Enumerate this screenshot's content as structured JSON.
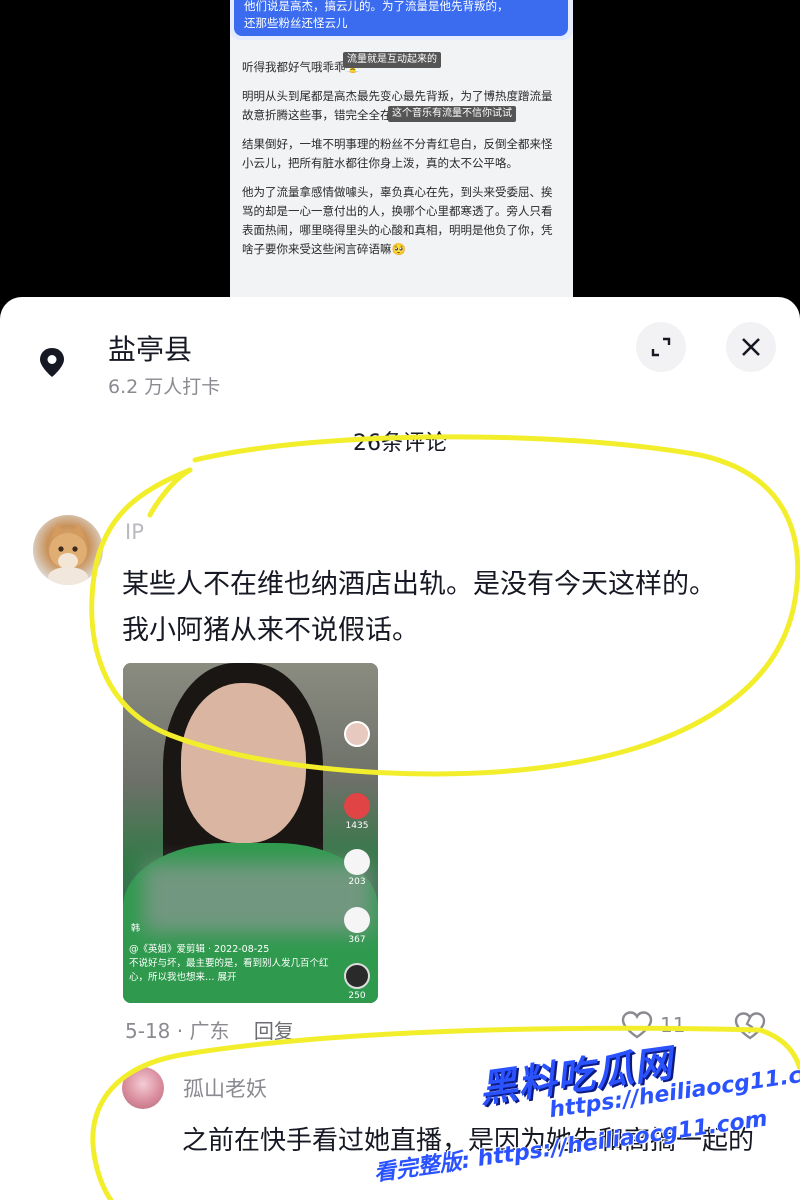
{
  "background_chat": {
    "highlight_lines": [
      "他们说是高杰，搞云儿的。为了流量是他先背叛的，",
      "还那些粉丝还怪云儿"
    ],
    "overlay_tags": [
      "流量就是互动起来的",
      "这个音乐有流量不信你试试"
    ],
    "paragraphs": [
      "听得我都好气哦乖乖😤",
      "明明从头到尾都是高杰最先变心最先背叛，为了博热度蹭流量故意折腾这些事，错完全全在他身上！",
      "结果倒好，一堆不明事理的粉丝不分青红皂白，反倒全都来怪小云儿，把所有脏水都往你身上泼，真的太不公平咯。",
      "他为了流量拿感情做噱头，辜负真心在先，到头来受委屈、挨骂的却是一心一意付出的人，换哪个心里都寒透了。旁人只看表面热闹，哪里晓得里头的心酸和真相，明明是他负了你，凭啥子要你来受这些闲言碎语嘛🥺"
    ]
  },
  "location": {
    "icon": "location-pin-icon",
    "name": "盐亭县",
    "checkins": "6.2 万人打卡"
  },
  "comments_header": "26条评论",
  "comment": {
    "ip_label": "IP",
    "text": "某些人不在维也纳酒店出轨。是没有今天这样的。我小阿猪从来不说假话。",
    "video": {
      "caption_author": "@《英姐》爱剪辑 · 2022-08-25",
      "caption_text": "不说好与坏，最主要的是，看到别人发几百个红心，所以我也想来… 展开",
      "corner_text": "韩",
      "counts": [
        "1435",
        "203",
        "367",
        "250"
      ]
    },
    "date_location": "5-18 · 广东",
    "reply_label": "回复",
    "like_count": "11"
  },
  "reply": {
    "name": "孤山老妖",
    "text": "之前在快手看过她直播，是因为她先和高搞一起的"
  },
  "watermark": {
    "title": "黑料吃瓜网",
    "url": "https://heiliaocg11.com",
    "line": "看完整版: https://heiliaocg11.com"
  },
  "colors": {
    "annotation": "#f2ee2c",
    "watermark": "#2a52ff",
    "chat_highlight": "#3b6cf0"
  }
}
